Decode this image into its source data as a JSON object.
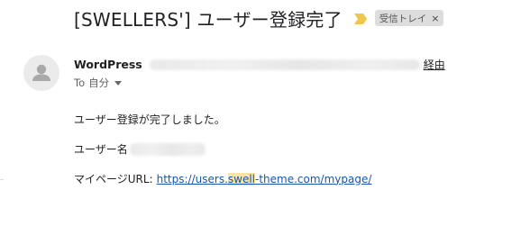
{
  "subject": {
    "text": "[SWELLERS'] ユーザー登録完了",
    "importance_icon": "importance-marker-icon",
    "importance_color": "#f2c54b",
    "label": "受信トレイ",
    "label_close": "×"
  },
  "sender": {
    "name": "WordPress",
    "via": "経由",
    "to_prefix": "To",
    "to_recipient": "自分",
    "avatar_icon": "person-icon"
  },
  "body": {
    "line1": "ユーザー登録が完了しました。",
    "line2_label": "ユーザー名",
    "line3_label": "マイページURL:",
    "url_before": "https://users.",
    "url_highlight": "swell",
    "url_after": "-theme.com/mypage/"
  },
  "colors": {
    "link": "#1a56a8",
    "highlight": "#fbe3a4",
    "chip_bg": "#dddddd"
  }
}
